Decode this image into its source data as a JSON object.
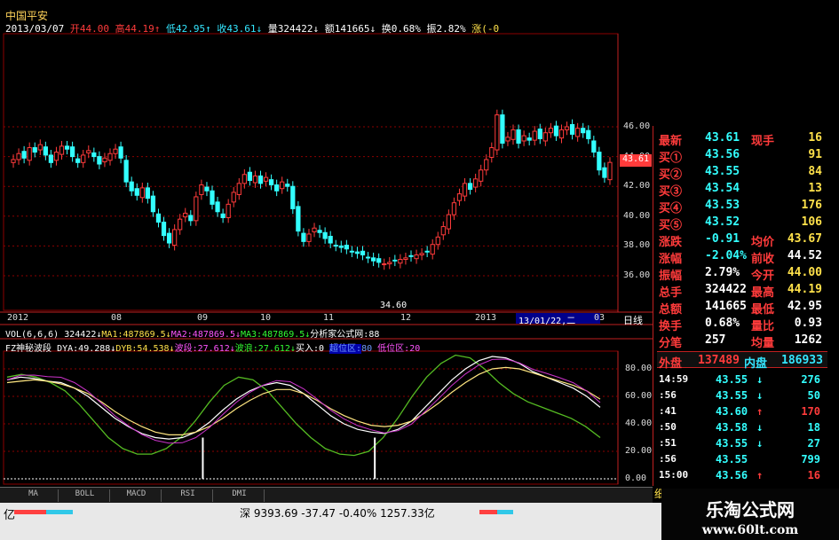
{
  "header": {
    "stock_name": "中国平安",
    "date": "2013/03/07",
    "open_label": "开",
    "open": "44.00",
    "high_label": "高",
    "high": "44.19",
    "low_label": "低",
    "low": "42.95",
    "close_label": "收",
    "close": "43.61",
    "volume_label": "量",
    "volume": "324422",
    "amount_label": "额",
    "amount": "141665",
    "turnover_label": "换",
    "turnover": "0.68%",
    "amplitude_label": "振",
    "amplitude": "2.82%",
    "change_label": "涨",
    "change": "(-0"
  },
  "price_axis": {
    "ticks": [
      "46.00",
      "44.00",
      "42.00",
      "40.00",
      "38.00",
      "36.00"
    ],
    "current_price_tag": "43.61",
    "low_marker": "34.60"
  },
  "time_axis": {
    "ticks": [
      "2012",
      "08",
      "09",
      "10",
      "11",
      "12",
      "2013",
      "03"
    ],
    "cursor_label": "13/01/22,二",
    "period": "日线"
  },
  "vol_line": {
    "title": "VOL(6,6,6)",
    "value": "324422",
    "ma1_label": "MA1:",
    "ma1": "487869.5",
    "ma2_label": "MA2:",
    "ma2": "487869.5",
    "ma3_label": "MA3:",
    "ma3": "487869.5",
    "source": "分析家公式网:88"
  },
  "indicator": {
    "name": "FZ神秘波段",
    "dya_label": "DYA:",
    "dya": "49.288",
    "dyb_label": "DYB:",
    "dyb": "54.538",
    "bd_label": "波段:",
    "bd": "27.612",
    "bl_label": "波浪:",
    "bl": "27.612",
    "buy_label": "买入:",
    "buy": "0",
    "high_zone_label": "超位区:",
    "high_zone": "80",
    "low_zone_label": "低位区:",
    "low_zone": "20",
    "axis_ticks": [
      "80.00",
      "60.00",
      "40.00",
      "20.00",
      "0.00"
    ]
  },
  "quote_panel": {
    "rows": [
      {
        "label": "最新",
        "value": "43.61",
        "label2": "现手",
        "value2": "16"
      },
      {
        "label": "买①",
        "value": "43.56",
        "label2": "",
        "value2": "91"
      },
      {
        "label": "买②",
        "value": "43.55",
        "label2": "",
        "value2": "84"
      },
      {
        "label": "买③",
        "value": "43.54",
        "label2": "",
        "value2": "13"
      },
      {
        "label": "买④",
        "value": "43.53",
        "label2": "",
        "value2": "176"
      },
      {
        "label": "买⑤",
        "value": "43.52",
        "label2": "",
        "value2": "106"
      },
      {
        "label": "涨跌",
        "value": "-0.91",
        "label2": "均价",
        "value2": "43.67"
      },
      {
        "label": "涨幅",
        "value": "-2.04%",
        "label2": "前收",
        "value2": "44.52"
      },
      {
        "label": "振幅",
        "value": "2.79%",
        "label2": "今开",
        "value2": "44.00"
      },
      {
        "label": "总手",
        "value": "324422",
        "label2": "最高",
        "value2": "44.19"
      },
      {
        "label": "总额",
        "value": "141665",
        "label2": "最低",
        "value2": "42.95"
      },
      {
        "label": "换手",
        "value": "0.68%",
        "label2": "量比",
        "value2": "0.93"
      },
      {
        "label": "分笔",
        "value": "257",
        "label2": "均量",
        "value2": "1262"
      }
    ],
    "outer_label": "外盘",
    "outer": "137489",
    "inner_label": "内盘",
    "inner": "186933",
    "ticks": [
      {
        "time": "14:59",
        "price": "43.55",
        "dir": "↓",
        "vol": "276"
      },
      {
        "time": ":56",
        "price": "43.55",
        "dir": "↓",
        "vol": "50"
      },
      {
        "time": ":41",
        "price": "43.60",
        "dir": "↑",
        "vol": "170"
      },
      {
        "time": ":50",
        "price": "43.58",
        "dir": "↓",
        "vol": "18"
      },
      {
        "time": ":51",
        "price": "43.55",
        "dir": "↓",
        "vol": "27"
      },
      {
        "time": ":56",
        "price": "43.55",
        "dir": "",
        "vol": "799"
      },
      {
        "time": "15:00",
        "price": "43.56",
        "dir": "↑",
        "vol": "16"
      }
    ],
    "detail_tab": "细"
  },
  "bottom_tabs": [
    "MA",
    "BOLL",
    "MACD",
    "RSI",
    "DMI"
  ],
  "status_bar": {
    "left_unit": "亿",
    "market": "深",
    "index": "9393.69",
    "change": "-37.47",
    "pct": "-0.40%",
    "amount": "1257.33亿"
  },
  "watermark": {
    "title": "乐淘公式网",
    "url": "www.60lt.com"
  },
  "colors": {
    "up": "#ff3b3b",
    "down": "#33ffff",
    "grid": "#8b0000",
    "accent": "#ffe14a"
  },
  "chart_data": {
    "type": "candlestick",
    "title": "中国平安",
    "y_range": [
      34,
      47
    ],
    "closes": [
      43.8,
      44.2,
      43.9,
      44.6,
      44.3,
      44.8,
      44.1,
      43.6,
      44.3,
      44.7,
      44.5,
      44.0,
      43.6,
      44.1,
      44.4,
      44.0,
      43.5,
      43.9,
      44.2,
      44.5,
      43.9,
      42.3,
      41.7,
      41.4,
      41.9,
      41.2,
      40.3,
      39.6,
      38.7,
      38.2,
      39.1,
      39.8,
      40.2,
      39.7,
      41.3,
      42.1,
      41.7,
      40.8,
      40.3,
      39.9,
      40.8,
      41.6,
      42.2,
      42.8,
      42.4,
      42.7,
      42.2,
      42.6,
      42.1,
      41.7,
      42.3,
      42.0,
      40.5,
      39.0,
      38.3,
      38.8,
      39.2,
      38.9,
      38.5,
      38.2,
      38.0,
      37.9,
      37.8,
      37.6,
      37.5,
      37.4,
      37.2,
      37.0,
      36.9,
      36.8,
      36.9,
      37.0,
      37.1,
      37.2,
      37.3,
      37.4,
      37.5,
      37.6,
      38.1,
      38.6,
      39.3,
      40.1,
      40.9,
      41.5,
      42.2,
      41.8,
      42.5,
      43.1,
      43.8,
      44.6,
      46.8,
      44.9,
      45.3,
      45.8,
      44.9,
      45.4,
      45.1,
      45.7,
      45.2,
      45.6,
      45.9,
      45.4,
      45.8,
      46.0,
      45.5,
      45.9,
      45.6,
      45.2,
      44.3,
      43.1,
      42.6,
      43.61
    ],
    "dya": [
      72,
      74,
      73,
      71,
      70,
      66,
      60,
      52,
      44,
      38,
      33,
      30,
      29,
      30,
      34,
      41,
      50,
      58,
      64,
      68,
      70,
      68,
      62,
      54,
      46,
      40,
      36,
      34,
      33,
      36,
      42,
      52,
      62,
      72,
      80,
      86,
      89,
      88,
      84,
      78,
      74,
      70,
      66,
      60,
      52
    ],
    "dyb": [
      70,
      71,
      72,
      71,
      69,
      66,
      62,
      56,
      49,
      43,
      38,
      34,
      32,
      32,
      34,
      38,
      44,
      51,
      57,
      62,
      65,
      65,
      62,
      57,
      51,
      46,
      42,
      39,
      38,
      39,
      42,
      48,
      55,
      63,
      70,
      76,
      80,
      81,
      80,
      77,
      74,
      71,
      68,
      64,
      58
    ],
    "wave": [
      74,
      76,
      74,
      70,
      64,
      54,
      42,
      30,
      22,
      18,
      18,
      22,
      30,
      42,
      56,
      68,
      74,
      72,
      64,
      52,
      40,
      30,
      22,
      18,
      17,
      20,
      30,
      44,
      60,
      74,
      84,
      90,
      88,
      80,
      70,
      62,
      56,
      52,
      48,
      44,
      38,
      30
    ],
    "buy_signals_x": [
      0.33,
      0.62
    ]
  }
}
